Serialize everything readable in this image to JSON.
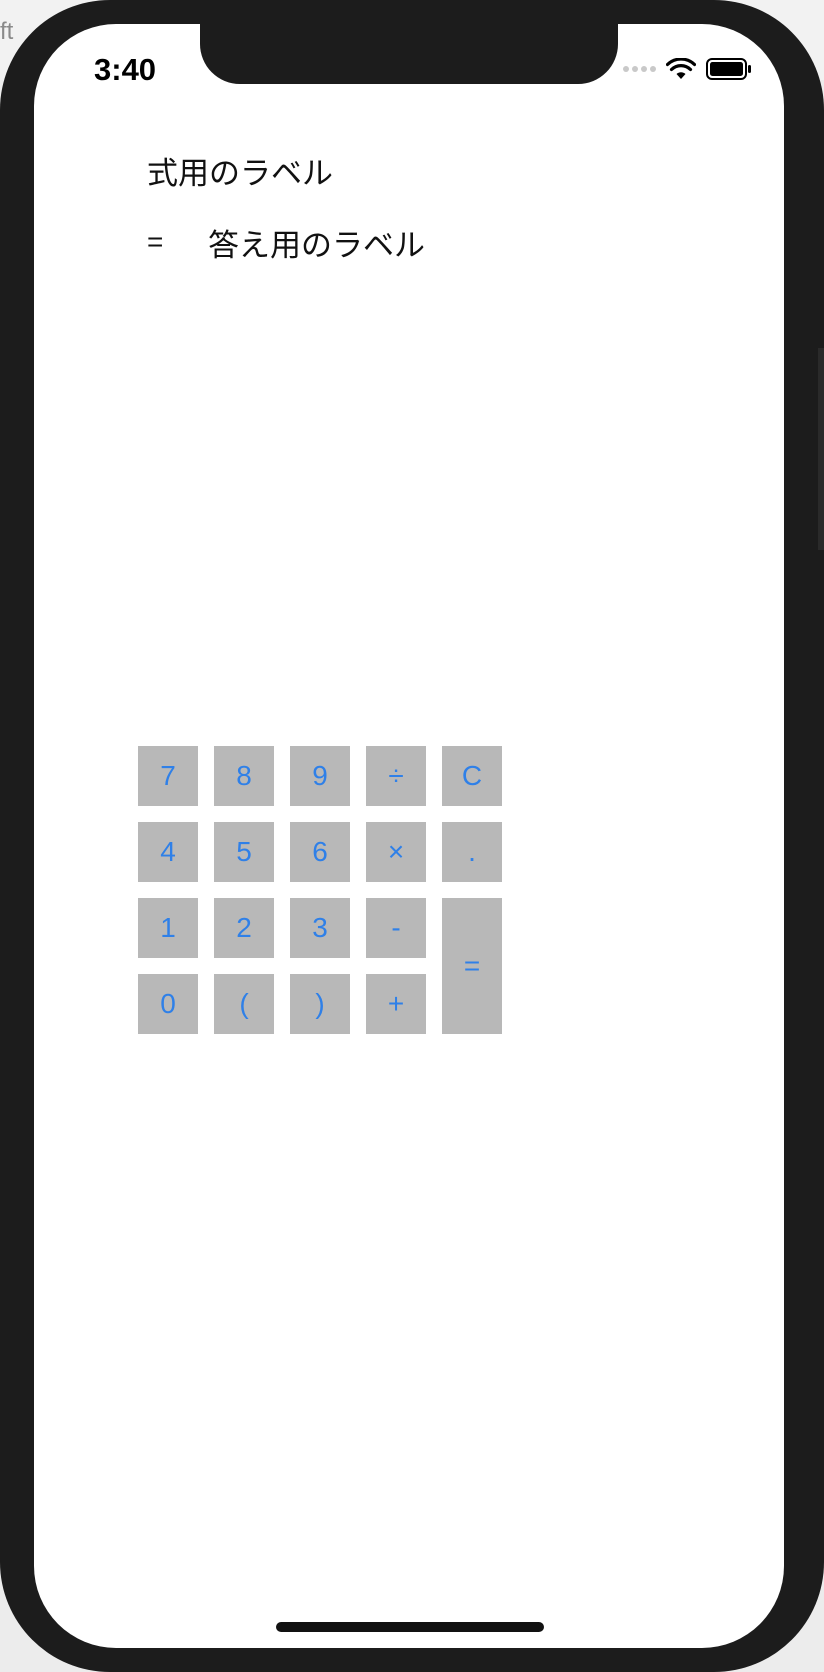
{
  "backdrop": {
    "text": "ft"
  },
  "status_bar": {
    "time": "3:40",
    "icons": [
      "signal-dots-icon",
      "wifi-icon",
      "battery-icon"
    ]
  },
  "labels": {
    "expression": "式用のラベル",
    "equals": "=",
    "answer": "答え用のラベル"
  },
  "keypad": {
    "key_color": "#b8b8b8",
    "text_color": "#2f80e8",
    "keys": {
      "k7": "7",
      "k8": "8",
      "k9": "9",
      "divide": "÷",
      "clear": "C",
      "k4": "4",
      "k5": "5",
      "k6": "6",
      "multiply": "×",
      "dot": ".",
      "k1": "1",
      "k2": "2",
      "k3": "3",
      "minus": "-",
      "equals": "=",
      "k0": "0",
      "lparen": "(",
      "rparen": ")",
      "plus": "+"
    }
  }
}
